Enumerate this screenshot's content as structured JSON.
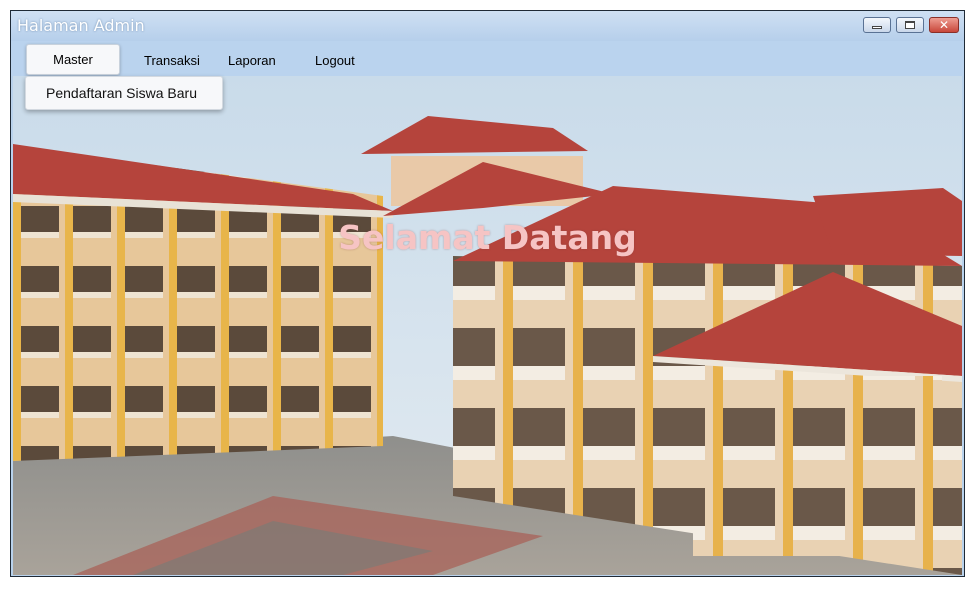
{
  "window": {
    "title": "Halaman Admin",
    "controls": {
      "minimize": "minimize-icon",
      "maximize": "maximize-icon",
      "close": "close-icon"
    }
  },
  "menubar": {
    "items": [
      {
        "label": "Master"
      },
      {
        "label": "Transaksi"
      },
      {
        "label": "Laporan"
      },
      {
        "label": "Logout"
      }
    ]
  },
  "dropdown": {
    "items": [
      {
        "label": "Pendaftaran Siswa Baru"
      }
    ]
  },
  "main": {
    "welcome_text": "Selamat Datang",
    "background_image": "school-building-photo"
  },
  "colors": {
    "titlebar": "#bad3ee",
    "roof": "#b5443c",
    "welcome_text": "#f6c4c4"
  }
}
